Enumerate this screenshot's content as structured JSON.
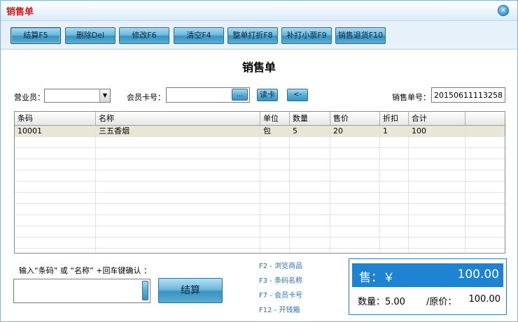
{
  "window": {
    "title": "销售单",
    "close_icon": "×"
  },
  "toolbar": [
    {
      "name": "checkout-f5-button",
      "label": "结算F5"
    },
    {
      "name": "delete-button",
      "label": "删除Del"
    },
    {
      "name": "modify-button",
      "label": "修改F6"
    },
    {
      "name": "clear-button",
      "label": "清空F4"
    },
    {
      "name": "whole-discount-button",
      "label": "整单打折F8"
    },
    {
      "name": "reprint-receipt-button",
      "label": "补打小票F9"
    },
    {
      "name": "sales-return-button",
      "label": "销售退货F10"
    }
  ],
  "heading": "销售单",
  "form": {
    "salesperson_label": "营业员：",
    "salesperson_value": "",
    "member_card_label": "会员卡号：",
    "member_card_value": "",
    "browse_label": "...",
    "read_card_label": "读卡",
    "back_label": "<-",
    "order_no_label": "销售单号：",
    "order_no_value": "20150611113258"
  },
  "table": {
    "columns": [
      "条码",
      "名称",
      "单位",
      "数量",
      "售价",
      "折扣",
      "合计"
    ],
    "rows": [
      [
        "10001",
        "三五香烟",
        "包",
        "5",
        "20",
        "1",
        "100"
      ]
    ]
  },
  "entry": {
    "hint": "输入“条码” 或 “名称” +回车键确认 ：",
    "value": "",
    "checkout_label": "结算"
  },
  "shortcuts": [
    "F2 - 浏览商品",
    "F3 - 条码名称",
    "F7  - 会员卡号",
    "F12 - 开钱箱"
  ],
  "summary": {
    "sale_label": "售：￥",
    "sale_amount": "100.00",
    "qty_label": "数量：5.00",
    "orig_label": "/原价：",
    "orig_amount": "100.00"
  },
  "colors": {
    "title": "#d81818",
    "accent": "#1f83d3",
    "shortcut": "#2a6fb7"
  }
}
